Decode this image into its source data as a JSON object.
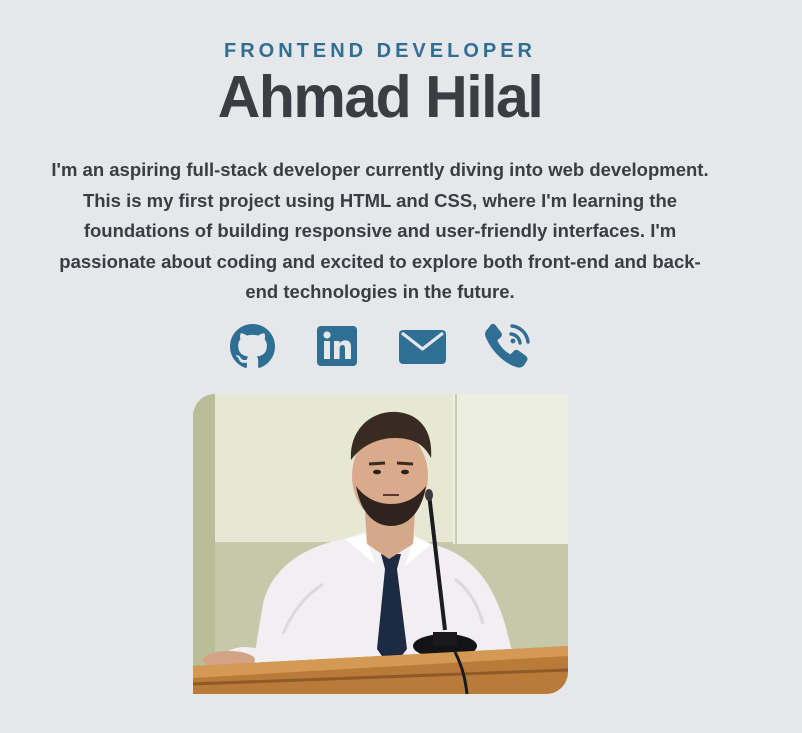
{
  "profile": {
    "role": "FRONTEND DEVELOPER",
    "name": "Ahmad Hilal",
    "bio": "I'm an aspiring full-stack developer currently diving into web development. This is my first project using HTML and CSS, where I'm learning the foundations of building responsive and user-friendly interfaces. I'm passionate about coding and excited to explore both front-end and back-end technologies in the future."
  },
  "socials": [
    {
      "icon": "github-icon"
    },
    {
      "icon": "linkedin-icon"
    },
    {
      "icon": "mail-icon"
    },
    {
      "icon": "phone-icon"
    }
  ],
  "colors": {
    "background": "#e5e7eb",
    "accent": "#2f6f93",
    "text": "#3a3d43"
  }
}
